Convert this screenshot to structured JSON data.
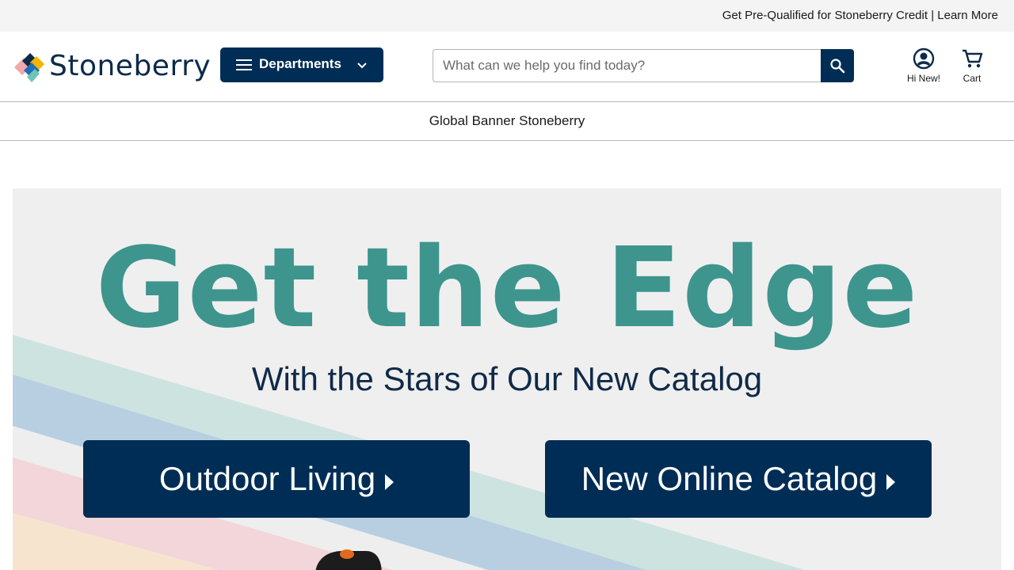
{
  "top_bar": {
    "credit_text": "Get Pre-Qualified for Stoneberry Credit",
    "separator": "|",
    "learn_more": "Learn More"
  },
  "header": {
    "logo_text": "Stoneberry",
    "departments_label": "Departments",
    "search_placeholder": "What can we help you find today?",
    "account_label": "Hi New!",
    "cart_label": "Cart"
  },
  "global_banner": {
    "text": "Global Banner Stoneberry"
  },
  "hero": {
    "title": "Get the Edge",
    "subtitle": "With the Stars of Our New Catalog",
    "cta_outdoor": "Outdoor Living",
    "cta_catalog": "New Online Catalog"
  },
  "colors": {
    "brand_navy": "#002d55",
    "hero_teal": "#3e958d",
    "hero_background": "#efefef"
  },
  "icons": {
    "menu": "hamburger-icon",
    "dropdown": "chevron-down-icon",
    "search": "search-icon",
    "account": "account-circle-icon",
    "cart": "cart-icon"
  }
}
